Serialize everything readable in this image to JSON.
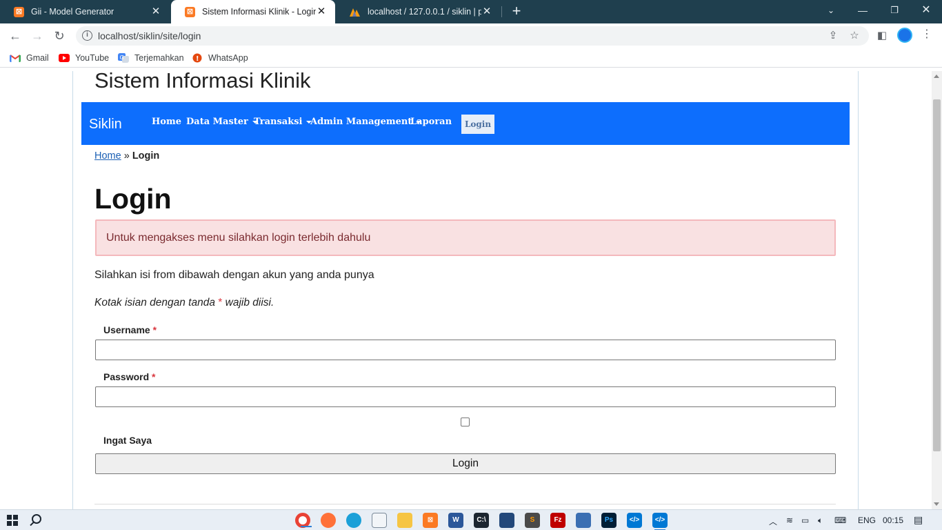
{
  "browser": {
    "tabs": [
      {
        "title": "Gii - Model Generator",
        "icon": "xampp-icon"
      },
      {
        "title": "Sistem Informasi Klinik - Login",
        "icon": "xampp-icon"
      },
      {
        "title": "localhost / 127.0.0.1 / siklin | php",
        "icon": "phpmyadmin-icon"
      }
    ],
    "url": "localhost/siklin/site/login",
    "bookmarks": [
      "Gmail",
      "YouTube",
      "Terjemahkan",
      "WhatsApp"
    ]
  },
  "site": {
    "title": "Sistem Informasi Klinik",
    "brand": "Siklin",
    "nav": {
      "home": "Home",
      "data_master": "Data Master",
      "transaksi": "Transaksi",
      "admin_management": "Admin Management",
      "laporan": "Laporan",
      "login": "Login"
    }
  },
  "breadcrumb": {
    "home": "Home",
    "separator": "»",
    "current": "Login"
  },
  "page": {
    "heading": "Login",
    "alert": "Untuk mengakses menu silahkan login terlebih dahulu",
    "intro": "Silahkan isi from dibawah dengan akun yang anda punya",
    "note_prefix": "Kotak isian dengan tanda",
    "note_mark": "*",
    "note_suffix": "wajib diisi."
  },
  "form": {
    "username_label": "Username",
    "password_label": "Password",
    "required_mark": "*",
    "username_value": "",
    "password_value": "",
    "remember_label": "Ingat Saya",
    "remember_checked": false,
    "submit_label": "Login"
  },
  "taskbar": {
    "language": "ENG",
    "time": "00:15"
  }
}
